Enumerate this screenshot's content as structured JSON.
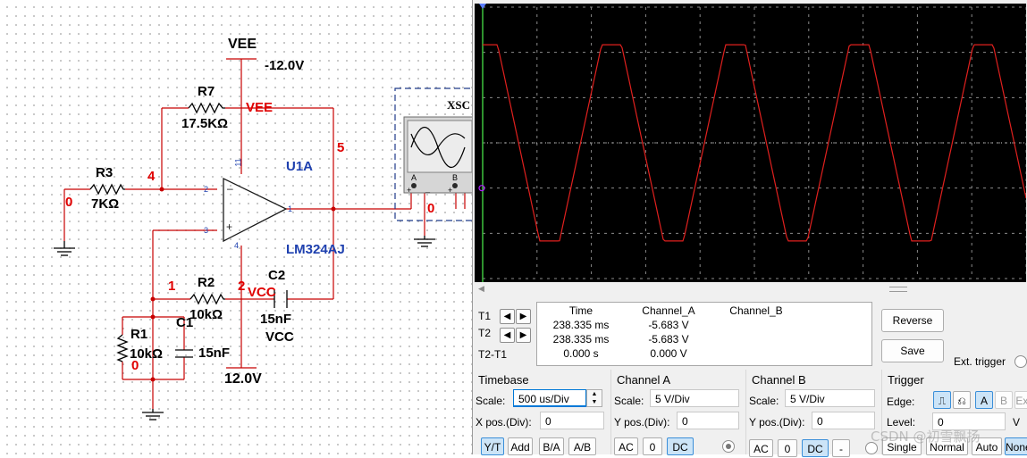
{
  "schematic": {
    "vee_net": "VEE",
    "vee_value": "-12.0V",
    "vee_pin_label": "VEE",
    "vcc_pin_label": "VCC",
    "vcc_net": "VCC",
    "vcc_value": "12.0V",
    "r7_ref": "R7",
    "r7_value": "17.5KΩ",
    "r3_ref": "R3",
    "r3_value": "7KΩ",
    "r2_ref": "R2",
    "r2_value": "10kΩ",
    "r1_ref": "R1",
    "r1_value": "10kΩ",
    "c2_ref": "C2",
    "c2_value": "15nF",
    "c1_ref": "C1",
    "c1_value": "15nF",
    "opamp_ref": "U1A",
    "opamp_part": "LM324AJ",
    "pin_11": "11",
    "pin_4": "4",
    "pin_2": "2",
    "pin_3": "3",
    "pin_1": "1",
    "node_4": "4",
    "node_5": "5",
    "node_1": "1",
    "node_2": "2",
    "node_0_left": "0",
    "node_0_out": "0",
    "node_0_bottom": "0",
    "scope_ref": "XSC",
    "scope_a": "A",
    "scope_b": "B",
    "scope_plus": "+",
    "scope_minus": "_"
  },
  "scope": {
    "cursor": {
      "t1": "T1",
      "t2": "T2",
      "t2_t1": "T2-T1",
      "headers": [
        "Time",
        "Channel_A",
        "Channel_B"
      ],
      "rows": [
        [
          "238.335 ms",
          "-5.683 V",
          ""
        ],
        [
          "238.335 ms",
          "-5.683 V",
          ""
        ],
        [
          "0.000 s",
          "0.000 V",
          ""
        ]
      ]
    },
    "buttons": {
      "reverse": "Reverse",
      "save": "Save",
      "ext_trigger": "Ext. trigger"
    },
    "timebase": {
      "title": "Timebase",
      "scale_label": "Scale:",
      "scale_value": "500 us/Div",
      "xpos_label": "X pos.(Div):",
      "xpos_value": "0",
      "modes": [
        "Y/T",
        "Add",
        "B/A",
        "A/B"
      ]
    },
    "channel_a": {
      "title": "Channel A",
      "scale_label": "Scale:",
      "scale_value": "5  V/Div",
      "ypos_label": "Y pos.(Div):",
      "ypos_value": "0",
      "coupling": [
        "AC",
        "0",
        "DC"
      ]
    },
    "channel_b": {
      "title": "Channel B",
      "scale_label": "Scale:",
      "scale_value": "5  V/Div",
      "ypos_label": "Y pos.(Div):",
      "ypos_value": "0",
      "coupling": [
        "AC",
        "0",
        "DC",
        "-"
      ]
    },
    "trigger": {
      "title": "Trigger",
      "edge_label": "Edge:",
      "level_label": "Level:",
      "level_value": "0",
      "level_unit": "V",
      "source": [
        "A",
        "B",
        "Ext"
      ],
      "modes": [
        "Single",
        "Normal",
        "Auto",
        "None"
      ]
    },
    "trace_color": "#e0201e",
    "chart_data": {
      "type": "line",
      "series": [
        {
          "values": [
            -10.8,
            10.8
          ]
        }
      ],
      "wave": "clipped triangle-like square wave",
      "amplitude_div": 2.17,
      "period_div": 2.28,
      "cycles_visible": 5
    }
  },
  "watermark": "CSDN @初雪飘扬"
}
